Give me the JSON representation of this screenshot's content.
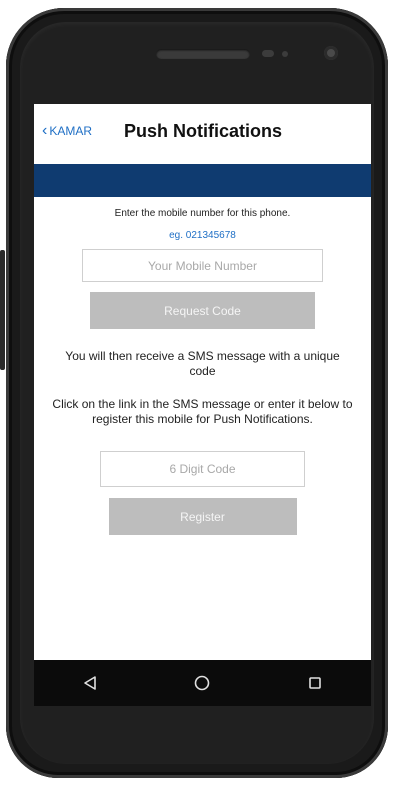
{
  "header": {
    "back_label": "KAMAR",
    "title": "Push Notifications"
  },
  "form": {
    "instruction": "Enter the mobile number for this phone.",
    "example": "eg. 021345678",
    "mobile_placeholder": "Your Mobile Number",
    "request_button": "Request Code",
    "sms_info": "You will then receive a SMS message with a unique code",
    "link_info": "Click on the link in the SMS message or enter it below to register this mobile for Push Notifications.",
    "code_placeholder": "6 Digit Code",
    "register_button": "Register"
  },
  "navbar": {
    "icons": [
      "back-triangle-icon",
      "home-circle-icon",
      "recents-square-icon"
    ]
  },
  "colors": {
    "accent": "#1f6fc5",
    "band": "#0f3b70",
    "button_disabled": "#bdbdbd"
  }
}
